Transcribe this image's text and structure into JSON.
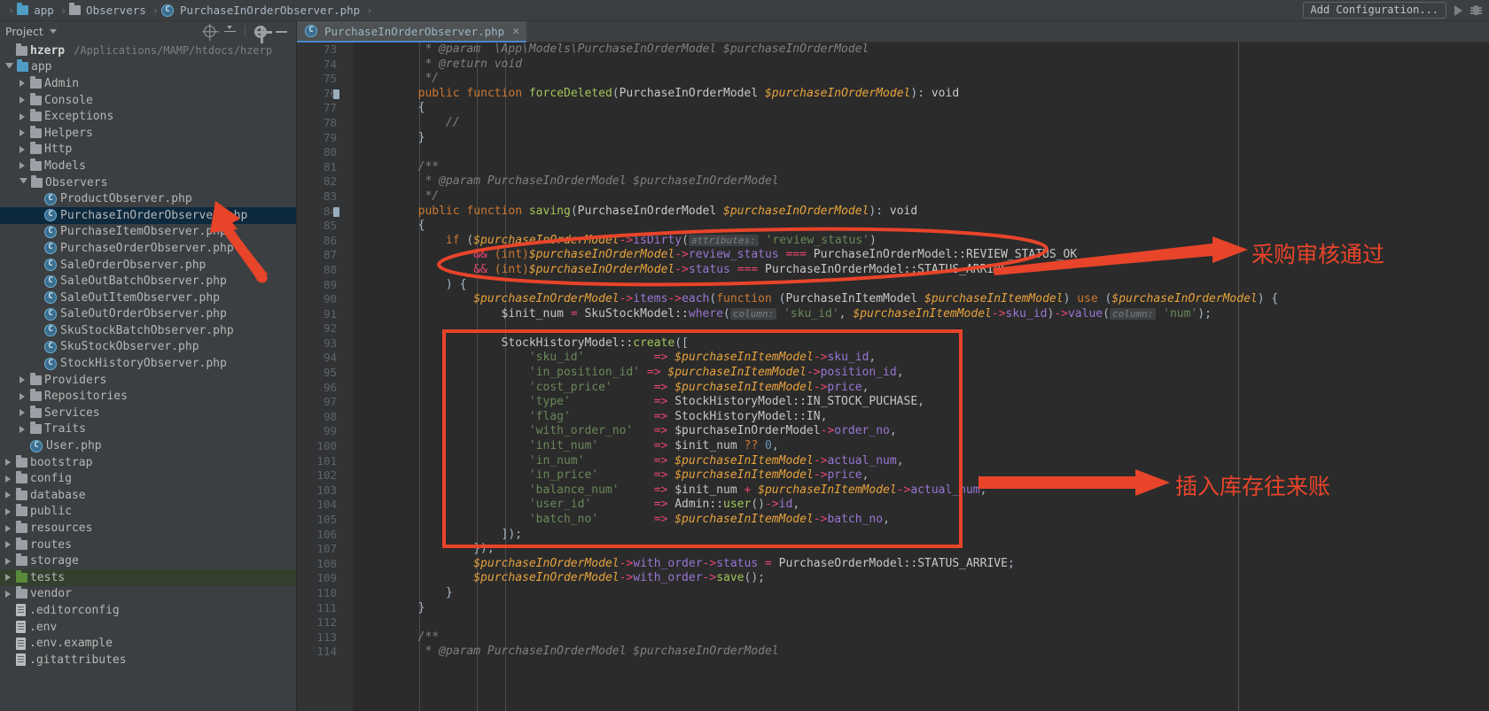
{
  "breadcrumb": {
    "items": [
      {
        "label": "app",
        "icon": "folder-icon-blue"
      },
      {
        "label": "Observers",
        "icon": "folder-icon"
      },
      {
        "label": "PurchaseInOrderObserver.php",
        "icon": "class-icon"
      }
    ]
  },
  "topbar": {
    "add_configuration_label": "Add Configuration...",
    "run_icon": "run-icon",
    "debug_icon": "debug-icon"
  },
  "sidebar": {
    "title": "Project",
    "caret_icon": "chevron-down-icon",
    "actions": [
      {
        "name": "locate-icon"
      },
      {
        "name": "collapse-all-icon"
      },
      {
        "name": "gear-icon"
      },
      {
        "name": "minimize-icon"
      }
    ],
    "tree": [
      {
        "depth": 0,
        "label": "hzerp",
        "arrow": "none",
        "icon": "folder-icon",
        "bold": true,
        "path": "/Applications/MAMP/htdocs/hzerp"
      },
      {
        "depth": 0,
        "label": "app",
        "arrow": "open",
        "icon": "folder-icon-blue"
      },
      {
        "depth": 1,
        "label": "Admin",
        "arrow": "closed",
        "icon": "folder-icon"
      },
      {
        "depth": 1,
        "label": "Console",
        "arrow": "closed",
        "icon": "folder-icon"
      },
      {
        "depth": 1,
        "label": "Exceptions",
        "arrow": "closed",
        "icon": "folder-icon"
      },
      {
        "depth": 1,
        "label": "Helpers",
        "arrow": "closed",
        "icon": "folder-icon"
      },
      {
        "depth": 1,
        "label": "Http",
        "arrow": "closed",
        "icon": "folder-icon"
      },
      {
        "depth": 1,
        "label": "Models",
        "arrow": "closed",
        "icon": "folder-icon"
      },
      {
        "depth": 1,
        "label": "Observers",
        "arrow": "open",
        "icon": "folder-icon"
      },
      {
        "depth": 2,
        "label": "ProductObserver.php",
        "arrow": "none",
        "icon": "class-icon"
      },
      {
        "depth": 2,
        "label": "PurchaseInOrderObserver.php",
        "arrow": "none",
        "icon": "class-icon",
        "selected": true
      },
      {
        "depth": 2,
        "label": "PurchaseItemObserver.php",
        "arrow": "none",
        "icon": "class-icon"
      },
      {
        "depth": 2,
        "label": "PurchaseOrderObserver.php",
        "arrow": "none",
        "icon": "class-icon"
      },
      {
        "depth": 2,
        "label": "SaleOrderObserver.php",
        "arrow": "none",
        "icon": "class-icon"
      },
      {
        "depth": 2,
        "label": "SaleOutBatchObserver.php",
        "arrow": "none",
        "icon": "class-icon"
      },
      {
        "depth": 2,
        "label": "SaleOutItemObserver.php",
        "arrow": "none",
        "icon": "class-icon"
      },
      {
        "depth": 2,
        "label": "SaleOutOrderObserver.php",
        "arrow": "none",
        "icon": "class-icon"
      },
      {
        "depth": 2,
        "label": "SkuStockBatchObserver.php",
        "arrow": "none",
        "icon": "class-icon"
      },
      {
        "depth": 2,
        "label": "SkuStockObserver.php",
        "arrow": "none",
        "icon": "class-icon"
      },
      {
        "depth": 2,
        "label": "StockHistoryObserver.php",
        "arrow": "none",
        "icon": "class-icon"
      },
      {
        "depth": 1,
        "label": "Providers",
        "arrow": "closed",
        "icon": "folder-icon"
      },
      {
        "depth": 1,
        "label": "Repositories",
        "arrow": "closed",
        "icon": "folder-icon"
      },
      {
        "depth": 1,
        "label": "Services",
        "arrow": "closed",
        "icon": "folder-icon"
      },
      {
        "depth": 1,
        "label": "Traits",
        "arrow": "closed",
        "icon": "folder-icon"
      },
      {
        "depth": 1,
        "label": "User.php",
        "arrow": "none",
        "icon": "class-icon"
      },
      {
        "depth": 0,
        "label": "bootstrap",
        "arrow": "closed",
        "icon": "folder-icon"
      },
      {
        "depth": 0,
        "label": "config",
        "arrow": "closed",
        "icon": "folder-icon"
      },
      {
        "depth": 0,
        "label": "database",
        "arrow": "closed",
        "icon": "folder-icon"
      },
      {
        "depth": 0,
        "label": "public",
        "arrow": "closed",
        "icon": "folder-icon"
      },
      {
        "depth": 0,
        "label": "resources",
        "arrow": "closed",
        "icon": "folder-icon"
      },
      {
        "depth": 0,
        "label": "routes",
        "arrow": "closed",
        "icon": "folder-icon"
      },
      {
        "depth": 0,
        "label": "storage",
        "arrow": "closed",
        "icon": "folder-icon"
      },
      {
        "depth": 0,
        "label": "tests",
        "arrow": "closed",
        "icon": "folder-icon-green",
        "greenrow": true
      },
      {
        "depth": 0,
        "label": "vendor",
        "arrow": "closed",
        "icon": "folder-icon"
      },
      {
        "depth": 0,
        "label": ".editorconfig",
        "arrow": "none",
        "icon": "file-icon"
      },
      {
        "depth": 0,
        "label": ".env",
        "arrow": "none",
        "icon": "file-icon"
      },
      {
        "depth": 0,
        "label": ".env.example",
        "arrow": "none",
        "icon": "file-icon"
      },
      {
        "depth": 0,
        "label": ".gitattributes",
        "arrow": "none",
        "icon": "file-icon"
      }
    ]
  },
  "editor": {
    "tab": {
      "label": "PurchaseInOrderObserver.php",
      "icon": "class-icon",
      "close_icon": "close-icon"
    },
    "first_line_number": 73,
    "lines": [
      {
        "n": 73,
        "html": "         <span class='cmt'>* @param  \\App\\Models\\PurchaseInOrderModel $purchaseInOrderModel</span>"
      },
      {
        "n": 74,
        "html": "         <span class='cmt'>* @return void</span>"
      },
      {
        "n": 75,
        "html": "         <span class='cmt'>*/</span>"
      },
      {
        "n": 76,
        "html": "        <span class='kw'>public function</span> <span class='fn'>forceDeleted</span>(<span class='cls'>PurchaseInOrderModel</span> <span class='var'>$purchaseInOrderModel</span>)<span class='op'>:</span> <span class='txt'>void</span>",
        "marker": true
      },
      {
        "n": 77,
        "html": "        {"
      },
      {
        "n": 78,
        "html": "            <span class='cmt'>//</span>"
      },
      {
        "n": 79,
        "html": "        }"
      },
      {
        "n": 80,
        "html": ""
      },
      {
        "n": 81,
        "html": "        <span class='cmt'>/**</span>"
      },
      {
        "n": 82,
        "html": "         <span class='cmt'>* @param PurchaseInOrderModel $purchaseInOrderModel</span>"
      },
      {
        "n": 83,
        "html": "         <span class='cmt'>*/</span>"
      },
      {
        "n": 84,
        "html": "        <span class='kw'>public function</span> <span class='fn'>saving</span>(<span class='cls'>PurchaseInOrderModel</span> <span class='var'>$purchaseInOrderModel</span>)<span class='op'>:</span> <span class='txt'>void</span>",
        "marker": true
      },
      {
        "n": 85,
        "html": "        {"
      },
      {
        "n": 86,
        "html": "            <span class='kw'>if</span> (<span class='var'>$purchaseInOrderModel</span><span class='arw'>-&gt;</span><span class='prop'>isDirty</span>(<span class='hint'>attributes:</span> <span class='str'>'review_status'</span>)"
      },
      {
        "n": 87,
        "html": "                <span class='kw2'>&amp;&amp;</span> <span class='kw'>(int)</span><span class='var'>$purchaseInOrderModel</span><span class='arw'>-&gt;</span><span class='prop'>review_status</span> <span class='kw2'>===</span> <span class='txt'>PurchaseInOrderModel::REVIEW_STATUS_OK</span>"
      },
      {
        "n": 88,
        "html": "                <span class='kw2'>&amp;&amp;</span> <span class='kw'>(int)</span><span class='var'>$purchaseInOrderModel</span><span class='arw'>-&gt;</span><span class='prop'>status</span> <span class='kw2'>===</span> <span class='txt'>PurchaseInOrderModel::STATUS_ARRIVE</span>"
      },
      {
        "n": 89,
        "html": "            ) {"
      },
      {
        "n": 90,
        "html": "                <span class='var'>$purchaseInOrderModel</span><span class='arw'>-&gt;</span><span class='prop'>items</span><span class='arw'>-&gt;</span><span class='prop'>each</span>(<span class='kw'>function</span> (<span class='cls'>PurchaseInItemModel</span> <span class='var'>$purchaseInItemModel</span>) <span class='kw'>use</span> (<span class='var'>$purchaseInOrderModel</span>) {"
      },
      {
        "n": 91,
        "html": "                    <span class='txt'>$init_num</span> <span class='kw2'>=</span> <span class='txt'>SkuStockModel::</span><span class='prop'>where</span>(<span class='hint'>column:</span> <span class='str'>'sku_id'</span>, <span class='var'>$purchaseInItemModel</span><span class='arw'>-&gt;</span><span class='prop'>sku_id</span>)<span class='arw'>-&gt;</span><span class='prop'>value</span>(<span class='hint'>column:</span> <span class='str'>'num'</span>);"
      },
      {
        "n": 92,
        "html": ""
      },
      {
        "n": 93,
        "html": "                    <span class='txt'>StockHistoryModel::</span><span class='fn'>create</span>(["
      },
      {
        "n": 94,
        "html": "                        <span class='str'>'sku_id'</span>          <span class='kw2'>=&gt;</span> <span class='var'>$purchaseInItemModel</span><span class='arw'>-&gt;</span><span class='prop'>sku_id</span>,"
      },
      {
        "n": 95,
        "html": "                        <span class='str'>'in_position_id'</span> <span class='kw2'>=&gt;</span> <span class='var'>$purchaseInItemModel</span><span class='arw'>-&gt;</span><span class='prop'>position_id</span>,"
      },
      {
        "n": 96,
        "html": "                        <span class='str'>'cost_price'</span>      <span class='kw2'>=&gt;</span> <span class='var'>$purchaseInItemModel</span><span class='arw'>-&gt;</span><span class='prop'>price</span>,"
      },
      {
        "n": 97,
        "html": "                        <span class='str'>'type'</span>            <span class='kw2'>=&gt;</span> <span class='txt'>StockHistoryModel::IN_STOCK_PUCHASE</span>,"
      },
      {
        "n": 98,
        "html": "                        <span class='str'>'flag'</span>            <span class='kw2'>=&gt;</span> <span class='txt'>StockHistoryModel::IN</span>,"
      },
      {
        "n": 99,
        "html": "                        <span class='str'>'with_order_no'</span>   <span class='kw2'>=&gt;</span> <span class='txt'>$purchaseInOrderModel</span><span class='arw'>-&gt;</span><span class='prop'>order_no</span>,"
      },
      {
        "n": 100,
        "html": "                        <span class='str'>'init_num'</span>        <span class='kw2'>=&gt;</span> <span class='txt'>$init_num</span> <span class='kw'>??</span> <span class='num'>0</span>,"
      },
      {
        "n": 101,
        "html": "                        <span class='str'>'in_num'</span>          <span class='kw2'>=&gt;</span> <span class='var'>$purchaseInItemModel</span><span class='arw'>-&gt;</span><span class='prop'>actual_num</span>,"
      },
      {
        "n": 102,
        "html": "                        <span class='str'>'in_price'</span>        <span class='kw2'>=&gt;</span> <span class='var'>$purchaseInItemModel</span><span class='arw'>-&gt;</span><span class='prop'>price</span>,"
      },
      {
        "n": 103,
        "html": "                        <span class='str'>'balance_num'</span>     <span class='kw2'>=&gt;</span> <span class='txt'>$init_num</span> <span class='kw2'>+</span> <span class='var'>$purchaseInItemModel</span><span class='arw'>-&gt;</span><span class='prop'>actual_num</span>,"
      },
      {
        "n": 104,
        "html": "                        <span class='str'>'user_id'</span>         <span class='kw2'>=&gt;</span> <span class='txt'>Admin::</span><span class='fn'>user</span>()<span class='arw'>-&gt;</span><span class='prop'>id</span>,"
      },
      {
        "n": 105,
        "html": "                        <span class='str'>'batch_no'</span>        <span class='kw2'>=&gt;</span> <span class='var'>$purchaseInItemModel</span><span class='arw'>-&gt;</span><span class='prop'>batch_no</span>,"
      },
      {
        "n": 106,
        "html": "                    ]);"
      },
      {
        "n": 107,
        "html": "                });"
      },
      {
        "n": 108,
        "html": "                <span class='var'>$purchaseInOrderModel</span><span class='arw'>-&gt;</span><span class='prop'>with_order</span><span class='arw'>-&gt;</span><span class='prop'>status</span> <span class='kw2'>=</span> <span class='txt'>PurchaseOrderModel::STATUS_ARRIVE</span>;"
      },
      {
        "n": 109,
        "html": "                <span class='var'>$purchaseInOrderModel</span><span class='arw'>-&gt;</span><span class='prop'>with_order</span><span class='arw'>-&gt;</span><span class='fn'>save</span>();"
      },
      {
        "n": 110,
        "html": "            }"
      },
      {
        "n": 111,
        "html": "        }"
      },
      {
        "n": 112,
        "html": ""
      },
      {
        "n": 113,
        "html": "        <span class='cmt'>/**</span>"
      },
      {
        "n": 114,
        "html": "         <span class='cmt'>* @param PurchaseInOrderModel $purchaseInOrderModel</span>"
      }
    ]
  },
  "annotations": {
    "color": "#e8442a",
    "ellipse_label": "review-condition-ellipse",
    "rect_label": "stock-history-create-rect",
    "arrow_to_sidebar_label": "arrow-to-selected-file",
    "notes": [
      {
        "text": "采购审核通过",
        "name": "annotation-purchase-review-passed"
      },
      {
        "text": "插入库存往来账",
        "name": "annotation-insert-stock-ledger"
      }
    ]
  }
}
